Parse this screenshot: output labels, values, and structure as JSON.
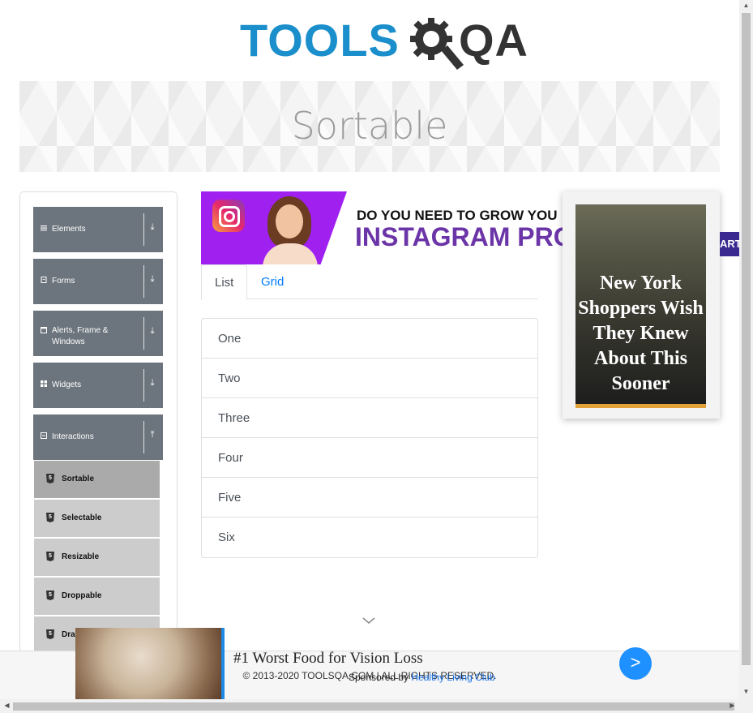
{
  "logo": {
    "text_tools": "TOOLS",
    "text_qa": "QA",
    "color_blue": "#1b8fcb",
    "color_dark": "#333333"
  },
  "page_title": "Sortable",
  "sidebar": {
    "groups": [
      {
        "label": "Elements",
        "icon": "menu-icon",
        "state": "collapsed"
      },
      {
        "label": "Forms",
        "icon": "form-icon",
        "state": "collapsed"
      },
      {
        "label": "Alerts, Frame & Windows",
        "icon": "window-icon",
        "state": "collapsed"
      },
      {
        "label": "Widgets",
        "icon": "widgets-icon",
        "state": "collapsed"
      },
      {
        "label": "Interactions",
        "icon": "interactions-icon",
        "state": "expanded"
      }
    ],
    "items": [
      {
        "label": "Sortable",
        "active": true
      },
      {
        "label": "Selectable",
        "active": false
      },
      {
        "label": "Resizable",
        "active": false
      },
      {
        "label": "Droppable",
        "active": false
      },
      {
        "label": "Dra",
        "active": false
      }
    ]
  },
  "ad_top": {
    "line1": "DO YOU NEED TO GROW YOU",
    "line2": "INSTAGRAM PRO"
  },
  "tabs": [
    {
      "label": "List",
      "active": true
    },
    {
      "label": "Grid",
      "active": false
    }
  ],
  "list_items": [
    "One",
    "Two",
    "Three",
    "Four",
    "Five",
    "Six"
  ],
  "ad_right": {
    "text": "New York Shoppers Wish They Knew About This Sooner"
  },
  "start_button": "ART",
  "footer": "© 2013-2020 TOOLSQA.COM | ALL RIGHTS RESERVED.",
  "ad_bottom": {
    "headline": "#1 Worst Food for Vision Loss",
    "sponsor_prefix": "Sponsored by ",
    "sponsor_brand": "Healthy Living Club",
    "go_symbol": ">"
  },
  "colors": {
    "accent_blue": "#007bff",
    "sidebar_group": "#6c757d",
    "ad_purple": "#6b35a8"
  }
}
